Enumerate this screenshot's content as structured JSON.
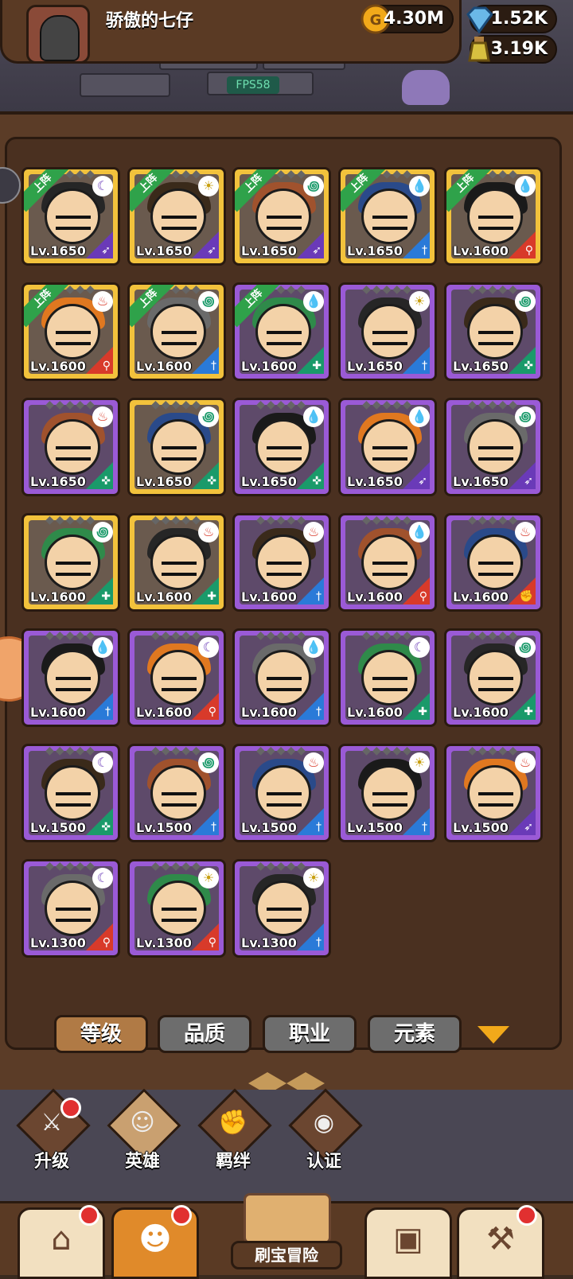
{
  "header": {
    "player_name": "骄傲的七仔",
    "gold": "4.30M",
    "gems": "1.52K",
    "potion": "3.19K",
    "fps": "FPS58"
  },
  "heroes": [
    {
      "level": "Lv.1650",
      "rarity": "gold",
      "deployed": true,
      "element": "moon",
      "role": "bow"
    },
    {
      "level": "Lv.1650",
      "rarity": "gold",
      "deployed": true,
      "element": "sun",
      "role": "bow"
    },
    {
      "level": "Lv.1650",
      "rarity": "gold",
      "deployed": true,
      "element": "wind",
      "role": "bow"
    },
    {
      "level": "Lv.1650",
      "rarity": "gold",
      "deployed": true,
      "element": "water",
      "role": "sword"
    },
    {
      "level": "Lv.1600",
      "rarity": "gold",
      "deployed": true,
      "element": "water",
      "role": "staff"
    },
    {
      "level": "Lv.1600",
      "rarity": "gold",
      "deployed": true,
      "element": "fire",
      "role": "staff"
    },
    {
      "level": "Lv.1600",
      "rarity": "gold",
      "deployed": true,
      "element": "wind",
      "role": "sword"
    },
    {
      "level": "Lv.1600",
      "rarity": "purple",
      "deployed": true,
      "element": "water",
      "role": "shield"
    },
    {
      "level": "Lv.1650",
      "rarity": "purple",
      "deployed": false,
      "element": "sun",
      "role": "sword"
    },
    {
      "level": "Lv.1650",
      "rarity": "purple",
      "deployed": false,
      "element": "wind",
      "role": "support"
    },
    {
      "level": "Lv.1650",
      "rarity": "purple",
      "deployed": false,
      "element": "fire",
      "role": "support"
    },
    {
      "level": "Lv.1650",
      "rarity": "gold",
      "deployed": false,
      "element": "wind",
      "role": "support"
    },
    {
      "level": "Lv.1650",
      "rarity": "purple",
      "deployed": false,
      "element": "water",
      "role": "support"
    },
    {
      "level": "Lv.1650",
      "rarity": "purple",
      "deployed": false,
      "element": "water",
      "role": "bow"
    },
    {
      "level": "Lv.1650",
      "rarity": "purple",
      "deployed": false,
      "element": "wind",
      "role": "bow"
    },
    {
      "level": "Lv.1600",
      "rarity": "gold",
      "deployed": false,
      "element": "wind",
      "role": "shield"
    },
    {
      "level": "Lv.1600",
      "rarity": "gold",
      "deployed": false,
      "element": "fire",
      "role": "shield"
    },
    {
      "level": "Lv.1600",
      "rarity": "purple",
      "deployed": false,
      "element": "fire",
      "role": "sword"
    },
    {
      "level": "Lv.1600",
      "rarity": "purple",
      "deployed": false,
      "element": "water",
      "role": "staff"
    },
    {
      "level": "Lv.1600",
      "rarity": "purple",
      "deployed": false,
      "element": "fire",
      "role": "fist"
    },
    {
      "level": "Lv.1600",
      "rarity": "purple",
      "deployed": false,
      "element": "water",
      "role": "sword"
    },
    {
      "level": "Lv.1600",
      "rarity": "purple",
      "deployed": false,
      "element": "moon",
      "role": "staff"
    },
    {
      "level": "Lv.1600",
      "rarity": "purple",
      "deployed": false,
      "element": "water",
      "role": "sword"
    },
    {
      "level": "Lv.1600",
      "rarity": "purple",
      "deployed": false,
      "element": "moon",
      "role": "shield"
    },
    {
      "level": "Lv.1600",
      "rarity": "purple",
      "deployed": false,
      "element": "wind",
      "role": "shield"
    },
    {
      "level": "Lv.1500",
      "rarity": "purple",
      "deployed": false,
      "element": "moon",
      "role": "support"
    },
    {
      "level": "Lv.1500",
      "rarity": "purple",
      "deployed": false,
      "element": "wind",
      "role": "sword"
    },
    {
      "level": "Lv.1500",
      "rarity": "purple",
      "deployed": false,
      "element": "fire",
      "role": "sword"
    },
    {
      "level": "Lv.1500",
      "rarity": "purple",
      "deployed": false,
      "element": "sun",
      "role": "sword"
    },
    {
      "level": "Lv.1500",
      "rarity": "purple",
      "deployed": false,
      "element": "fire",
      "role": "bow"
    },
    {
      "level": "Lv.1300",
      "rarity": "purple",
      "deployed": false,
      "element": "moon",
      "role": "staff"
    },
    {
      "level": "Lv.1300",
      "rarity": "purple",
      "deployed": false,
      "element": "sun",
      "role": "staff"
    },
    {
      "level": "Lv.1300",
      "rarity": "purple",
      "deployed": false,
      "element": "sun",
      "role": "sword"
    }
  ],
  "deploy_label": "上阵",
  "sort_tabs": [
    "等级",
    "品质",
    "职业",
    "元素"
  ],
  "subnav": [
    {
      "label": "升级",
      "icon": "sword-icon",
      "badge": true
    },
    {
      "label": "英雄",
      "icon": "hero-icon",
      "badge": false
    },
    {
      "label": "羁绊",
      "icon": "handshake-icon",
      "badge": false
    },
    {
      "label": "认证",
      "icon": "eye-icon",
      "badge": false
    }
  ],
  "bottom_nav": {
    "adventure_label": "刷宝冒险"
  },
  "colors": {
    "gold_card": "#f2c23c",
    "purple_card": "#9a5ad6",
    "deploy_ribbon": "#2fa24a",
    "active_tab": "#b07a45"
  }
}
